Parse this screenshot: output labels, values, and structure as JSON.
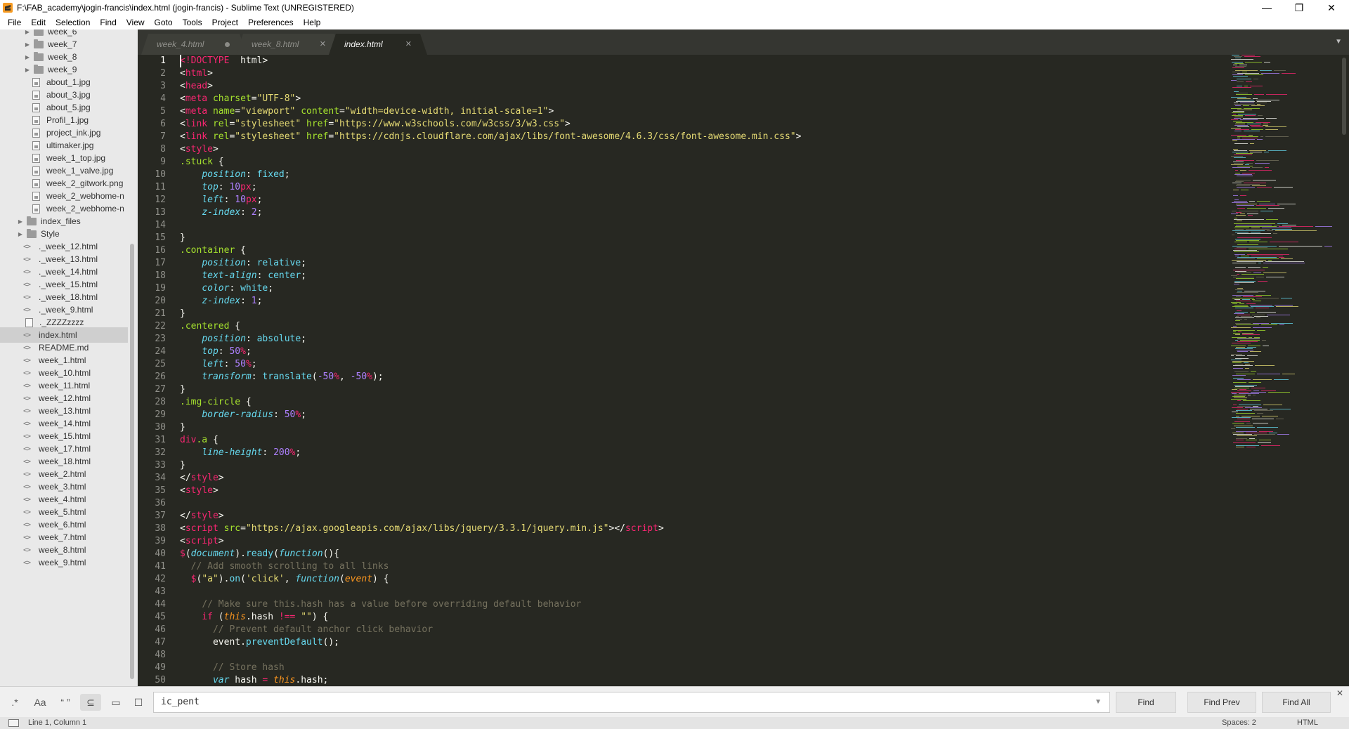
{
  "window": {
    "title": "F:\\FAB_academy\\jogin-francis\\index.html (jogin-francis) - Sublime Text (UNREGISTERED)",
    "controls": {
      "minimize": "—",
      "maximize": "❐",
      "close": "✕"
    }
  },
  "menu": [
    "File",
    "Edit",
    "Selection",
    "Find",
    "View",
    "Goto",
    "Tools",
    "Project",
    "Preferences",
    "Help"
  ],
  "sidebar": {
    "items": [
      {
        "label": "week_6",
        "type": "folder"
      },
      {
        "label": "week_7",
        "type": "folder"
      },
      {
        "label": "week_8",
        "type": "folder"
      },
      {
        "label": "week_9",
        "type": "folder"
      },
      {
        "label": "about_1.jpg",
        "type": "image"
      },
      {
        "label": "about_3.jpg",
        "type": "image"
      },
      {
        "label": "about_5.jpg",
        "type": "image"
      },
      {
        "label": "Profil_1.jpg",
        "type": "image"
      },
      {
        "label": "project_ink.jpg",
        "type": "image"
      },
      {
        "label": "ultimaker.jpg",
        "type": "image"
      },
      {
        "label": "week_1_top.jpg",
        "type": "image"
      },
      {
        "label": "week_1_valve.jpg",
        "type": "image"
      },
      {
        "label": "week_2_gitwork.png",
        "type": "image"
      },
      {
        "label": "week_2_webhome-n",
        "type": "image"
      },
      {
        "label": "week_2_webhome-n",
        "type": "image"
      },
      {
        "label": "index_files",
        "type": "folder-root"
      },
      {
        "label": "Style",
        "type": "folder-root"
      },
      {
        "label": "._week_12.html",
        "type": "code"
      },
      {
        "label": "._week_13.html",
        "type": "code"
      },
      {
        "label": "._week_14.html",
        "type": "code"
      },
      {
        "label": "._week_15.html",
        "type": "code"
      },
      {
        "label": "._week_18.html",
        "type": "code"
      },
      {
        "label": "._week_9.html",
        "type": "code"
      },
      {
        "label": "._ZZZZzzzz",
        "type": "file"
      },
      {
        "label": "index.html",
        "type": "code",
        "selected": true
      },
      {
        "label": "README.md",
        "type": "code"
      },
      {
        "label": "week_1.html",
        "type": "code"
      },
      {
        "label": "week_10.html",
        "type": "code"
      },
      {
        "label": "week_11.html",
        "type": "code"
      },
      {
        "label": "week_12.html",
        "type": "code"
      },
      {
        "label": "week_13.html",
        "type": "code"
      },
      {
        "label": "week_14.html",
        "type": "code"
      },
      {
        "label": "week_15.html",
        "type": "code"
      },
      {
        "label": "week_17.html",
        "type": "code"
      },
      {
        "label": "week_18.html",
        "type": "code"
      },
      {
        "label": "week_2.html",
        "type": "code"
      },
      {
        "label": "week_3.html",
        "type": "code"
      },
      {
        "label": "week_4.html",
        "type": "code"
      },
      {
        "label": "week_5.html",
        "type": "code"
      },
      {
        "label": "week_6.html",
        "type": "code"
      },
      {
        "label": "week_7.html",
        "type": "code"
      },
      {
        "label": "week_8.html",
        "type": "code"
      },
      {
        "label": "week_9.html",
        "type": "code"
      }
    ]
  },
  "tabs": [
    {
      "label": "week_4.html",
      "modified": true,
      "active": false
    },
    {
      "label": "week_8.html",
      "modified": false,
      "active": false
    },
    {
      "label": "index.html",
      "modified": false,
      "active": true
    }
  ],
  "editor": {
    "lines": [
      [
        [
          "t",
          "<!DOCTYPE"
        ],
        [
          "",
          "  html>"
        ]
      ],
      [
        [
          "",
          "<"
        ],
        [
          "t",
          "html"
        ],
        [
          "",
          ">"
        ]
      ],
      [
        [
          "",
          "<"
        ],
        [
          "t",
          "head"
        ],
        [
          "",
          ">"
        ]
      ],
      [
        [
          "",
          "<"
        ],
        [
          "t",
          "meta"
        ],
        [
          "a",
          " charset"
        ],
        [
          "",
          "="
        ],
        [
          "s",
          "\"UTF-8\""
        ],
        [
          "",
          ">"
        ]
      ],
      [
        [
          "",
          "<"
        ],
        [
          "t",
          "meta"
        ],
        [
          "a",
          " name"
        ],
        [
          "",
          "="
        ],
        [
          "s",
          "\"viewport\""
        ],
        [
          "a",
          " content"
        ],
        [
          "",
          "="
        ],
        [
          "s",
          "\"width=device-width, initial-scale=1\""
        ],
        [
          "",
          ">"
        ]
      ],
      [
        [
          "",
          "<"
        ],
        [
          "t",
          "link"
        ],
        [
          "a",
          " rel"
        ],
        [
          "",
          "="
        ],
        [
          "s",
          "\"stylesheet\""
        ],
        [
          "a",
          " href"
        ],
        [
          "",
          "="
        ],
        [
          "s",
          "\"https://www.w3schools.com/w3css/3/w3.css\""
        ],
        [
          "",
          ">"
        ]
      ],
      [
        [
          "",
          "<"
        ],
        [
          "t",
          "link"
        ],
        [
          "a",
          " rel"
        ],
        [
          "",
          "="
        ],
        [
          "s",
          "\"stylesheet\""
        ],
        [
          "a",
          " href"
        ],
        [
          "",
          "="
        ],
        [
          "s",
          "\"https://cdnjs.cloudflare.com/ajax/libs/font-awesome/4.6.3/css/font-awesome.min.css\""
        ],
        [
          "",
          ">"
        ]
      ],
      [
        [
          "",
          "<"
        ],
        [
          "t",
          "style"
        ],
        [
          "",
          ">"
        ]
      ],
      [
        [
          "sel",
          ".stuck"
        ],
        [
          "",
          " {"
        ]
      ],
      [
        [
          "",
          "    "
        ],
        [
          "p",
          "position"
        ],
        [
          "",
          ": "
        ],
        [
          "v",
          "fixed"
        ],
        [
          "",
          ";"
        ]
      ],
      [
        [
          "",
          "    "
        ],
        [
          "p",
          "top"
        ],
        [
          "",
          ": "
        ],
        [
          "n",
          "10"
        ],
        [
          "k",
          "px"
        ],
        [
          "",
          ";"
        ]
      ],
      [
        [
          "",
          "    "
        ],
        [
          "p",
          "left"
        ],
        [
          "",
          ": "
        ],
        [
          "n",
          "10"
        ],
        [
          "k",
          "px"
        ],
        [
          "",
          ";"
        ]
      ],
      [
        [
          "",
          "    "
        ],
        [
          "p",
          "z-index"
        ],
        [
          "",
          ": "
        ],
        [
          "n",
          "2"
        ],
        [
          "",
          ";"
        ]
      ],
      [],
      [
        [
          "",
          "}"
        ]
      ],
      [
        [
          "sel",
          ".container"
        ],
        [
          "",
          " {"
        ]
      ],
      [
        [
          "",
          "    "
        ],
        [
          "p",
          "position"
        ],
        [
          "",
          ": "
        ],
        [
          "v",
          "relative"
        ],
        [
          "",
          ";"
        ]
      ],
      [
        [
          "",
          "    "
        ],
        [
          "p",
          "text-align"
        ],
        [
          "",
          ": "
        ],
        [
          "v",
          "center"
        ],
        [
          "",
          ";"
        ]
      ],
      [
        [
          "",
          "    "
        ],
        [
          "p",
          "color"
        ],
        [
          "",
          ": "
        ],
        [
          "v",
          "white"
        ],
        [
          "",
          ";"
        ]
      ],
      [
        [
          "",
          "    "
        ],
        [
          "p",
          "z-index"
        ],
        [
          "",
          ": "
        ],
        [
          "n",
          "1"
        ],
        [
          "",
          ";"
        ]
      ],
      [
        [
          "",
          "}"
        ]
      ],
      [
        [
          "sel",
          ".centered"
        ],
        [
          "",
          " {"
        ]
      ],
      [
        [
          "",
          "    "
        ],
        [
          "p",
          "position"
        ],
        [
          "",
          ": "
        ],
        [
          "v",
          "absolute"
        ],
        [
          "",
          ";"
        ]
      ],
      [
        [
          "",
          "    "
        ],
        [
          "p",
          "top"
        ],
        [
          "",
          ": "
        ],
        [
          "n",
          "50"
        ],
        [
          "k",
          "%"
        ],
        [
          "",
          ";"
        ]
      ],
      [
        [
          "",
          "    "
        ],
        [
          "p",
          "left"
        ],
        [
          "",
          ": "
        ],
        [
          "n",
          "50"
        ],
        [
          "k",
          "%"
        ],
        [
          "",
          ";"
        ]
      ],
      [
        [
          "",
          "    "
        ],
        [
          "p",
          "transform"
        ],
        [
          "",
          ": "
        ],
        [
          "f",
          "translate"
        ],
        [
          "",
          "("
        ],
        [
          "n",
          "-50"
        ],
        [
          "k",
          "%"
        ],
        [
          "",
          ", "
        ],
        [
          "n",
          "-50"
        ],
        [
          "k",
          "%"
        ],
        [
          "",
          ");"
        ]
      ],
      [
        [
          "",
          "}"
        ]
      ],
      [
        [
          "sel",
          ".img-circle"
        ],
        [
          "",
          " {"
        ]
      ],
      [
        [
          "",
          "    "
        ],
        [
          "p",
          "border-radius"
        ],
        [
          "",
          ": "
        ],
        [
          "n",
          "50"
        ],
        [
          "k",
          "%"
        ],
        [
          "",
          ";"
        ]
      ],
      [
        [
          "",
          "}"
        ]
      ],
      [
        [
          "t",
          "div"
        ],
        [
          "sel",
          ".a"
        ],
        [
          "",
          " {"
        ]
      ],
      [
        [
          "",
          "    "
        ],
        [
          "p",
          "line-height"
        ],
        [
          "",
          ": "
        ],
        [
          "n",
          "200"
        ],
        [
          "k",
          "%"
        ],
        [
          "",
          ";"
        ]
      ],
      [
        [
          "",
          "}"
        ]
      ],
      [
        [
          "",
          "</"
        ],
        [
          "t",
          "style"
        ],
        [
          "",
          ">"
        ]
      ],
      [
        [
          "",
          "<"
        ],
        [
          "t",
          "style"
        ],
        [
          "",
          ">"
        ]
      ],
      [],
      [
        [
          "",
          "</"
        ],
        [
          "t",
          "style"
        ],
        [
          "",
          ">"
        ]
      ],
      [
        [
          "",
          "<"
        ],
        [
          "t",
          "script"
        ],
        [
          "a",
          " src"
        ],
        [
          "",
          "="
        ],
        [
          "s",
          "\"https://ajax.googleapis.com/ajax/libs/jquery/3.3.1/jquery.min.js\""
        ],
        [
          "",
          "></"
        ],
        [
          "t",
          "script"
        ],
        [
          "",
          ">"
        ]
      ],
      [
        [
          "",
          "<"
        ],
        [
          "t",
          "script"
        ],
        [
          "",
          ">"
        ]
      ],
      [
        [
          "k",
          "$"
        ],
        [
          "",
          "("
        ],
        [
          "i",
          "document"
        ],
        [
          "",
          ")."
        ],
        [
          "f",
          "ready"
        ],
        [
          "",
          "("
        ],
        [
          "i",
          "function"
        ],
        [
          "",
          "(){"
        ]
      ],
      [
        [
          "",
          "  "
        ],
        [
          "c",
          "// Add smooth scrolling to all links"
        ]
      ],
      [
        [
          "",
          "  "
        ],
        [
          "k",
          "$"
        ],
        [
          "",
          "("
        ],
        [
          "s",
          "\"a\""
        ],
        [
          "",
          ")."
        ],
        [
          "f",
          "on"
        ],
        [
          "",
          "("
        ],
        [
          "s",
          "'click'"
        ],
        [
          "",
          ", "
        ],
        [
          "i",
          "function"
        ],
        [
          "",
          "("
        ],
        [
          "pa",
          "event"
        ],
        [
          "",
          ") {"
        ]
      ],
      [],
      [
        [
          "",
          "    "
        ],
        [
          "c",
          "// Make sure this.hash has a value before overriding default behavior"
        ]
      ],
      [
        [
          "",
          "    "
        ],
        [
          "k",
          "if"
        ],
        [
          "",
          " ("
        ],
        [
          "pa",
          "this"
        ],
        [
          "",
          ".hash "
        ],
        [
          "k",
          "!=="
        ],
        [
          "",
          ""
        ],
        [
          "s",
          " \"\""
        ],
        [
          "",
          ") {"
        ]
      ],
      [
        [
          "",
          "      "
        ],
        [
          "c",
          "// Prevent default anchor click behavior"
        ]
      ],
      [
        [
          "",
          "      event."
        ],
        [
          "f",
          "preventDefault"
        ],
        [
          "",
          "();"
        ]
      ],
      [],
      [
        [
          "",
          "      "
        ],
        [
          "c",
          "// Store hash"
        ]
      ],
      [
        [
          "",
          "      "
        ],
        [
          "i",
          "var"
        ],
        [
          "",
          " hash "
        ],
        [
          "k",
          "="
        ],
        [
          "",
          " "
        ],
        [
          "pa",
          "this"
        ],
        [
          "",
          ".hash;"
        ]
      ]
    ]
  },
  "find_panel": {
    "options": [
      {
        "name": "regex-toggle",
        "glyph": ".*",
        "active": false
      },
      {
        "name": "case-toggle",
        "glyph": "Aa",
        "active": false
      },
      {
        "name": "whole-word-toggle",
        "glyph": "“ ”",
        "active": false
      },
      {
        "name": "wrap-toggle",
        "glyph": "⊆",
        "active": true
      },
      {
        "name": "in-selection-toggle",
        "glyph": "▭",
        "active": false
      },
      {
        "name": "highlight-toggle",
        "glyph": "☐",
        "active": false
      }
    ],
    "query": "ic_pent",
    "buttons": {
      "find": "Find",
      "find_prev": "Find Prev",
      "find_all": "Find All"
    },
    "close": "✕"
  },
  "status": {
    "position": "Line 1, Column 1",
    "spaces": "Spaces: 2",
    "syntax": "HTML"
  },
  "colors": {
    "background": "#272822",
    "tag": "#f92672",
    "attribute": "#a6e22e",
    "string": "#e6db74",
    "property": "#66d9ef",
    "number": "#ae81ff",
    "comment": "#75715e"
  }
}
